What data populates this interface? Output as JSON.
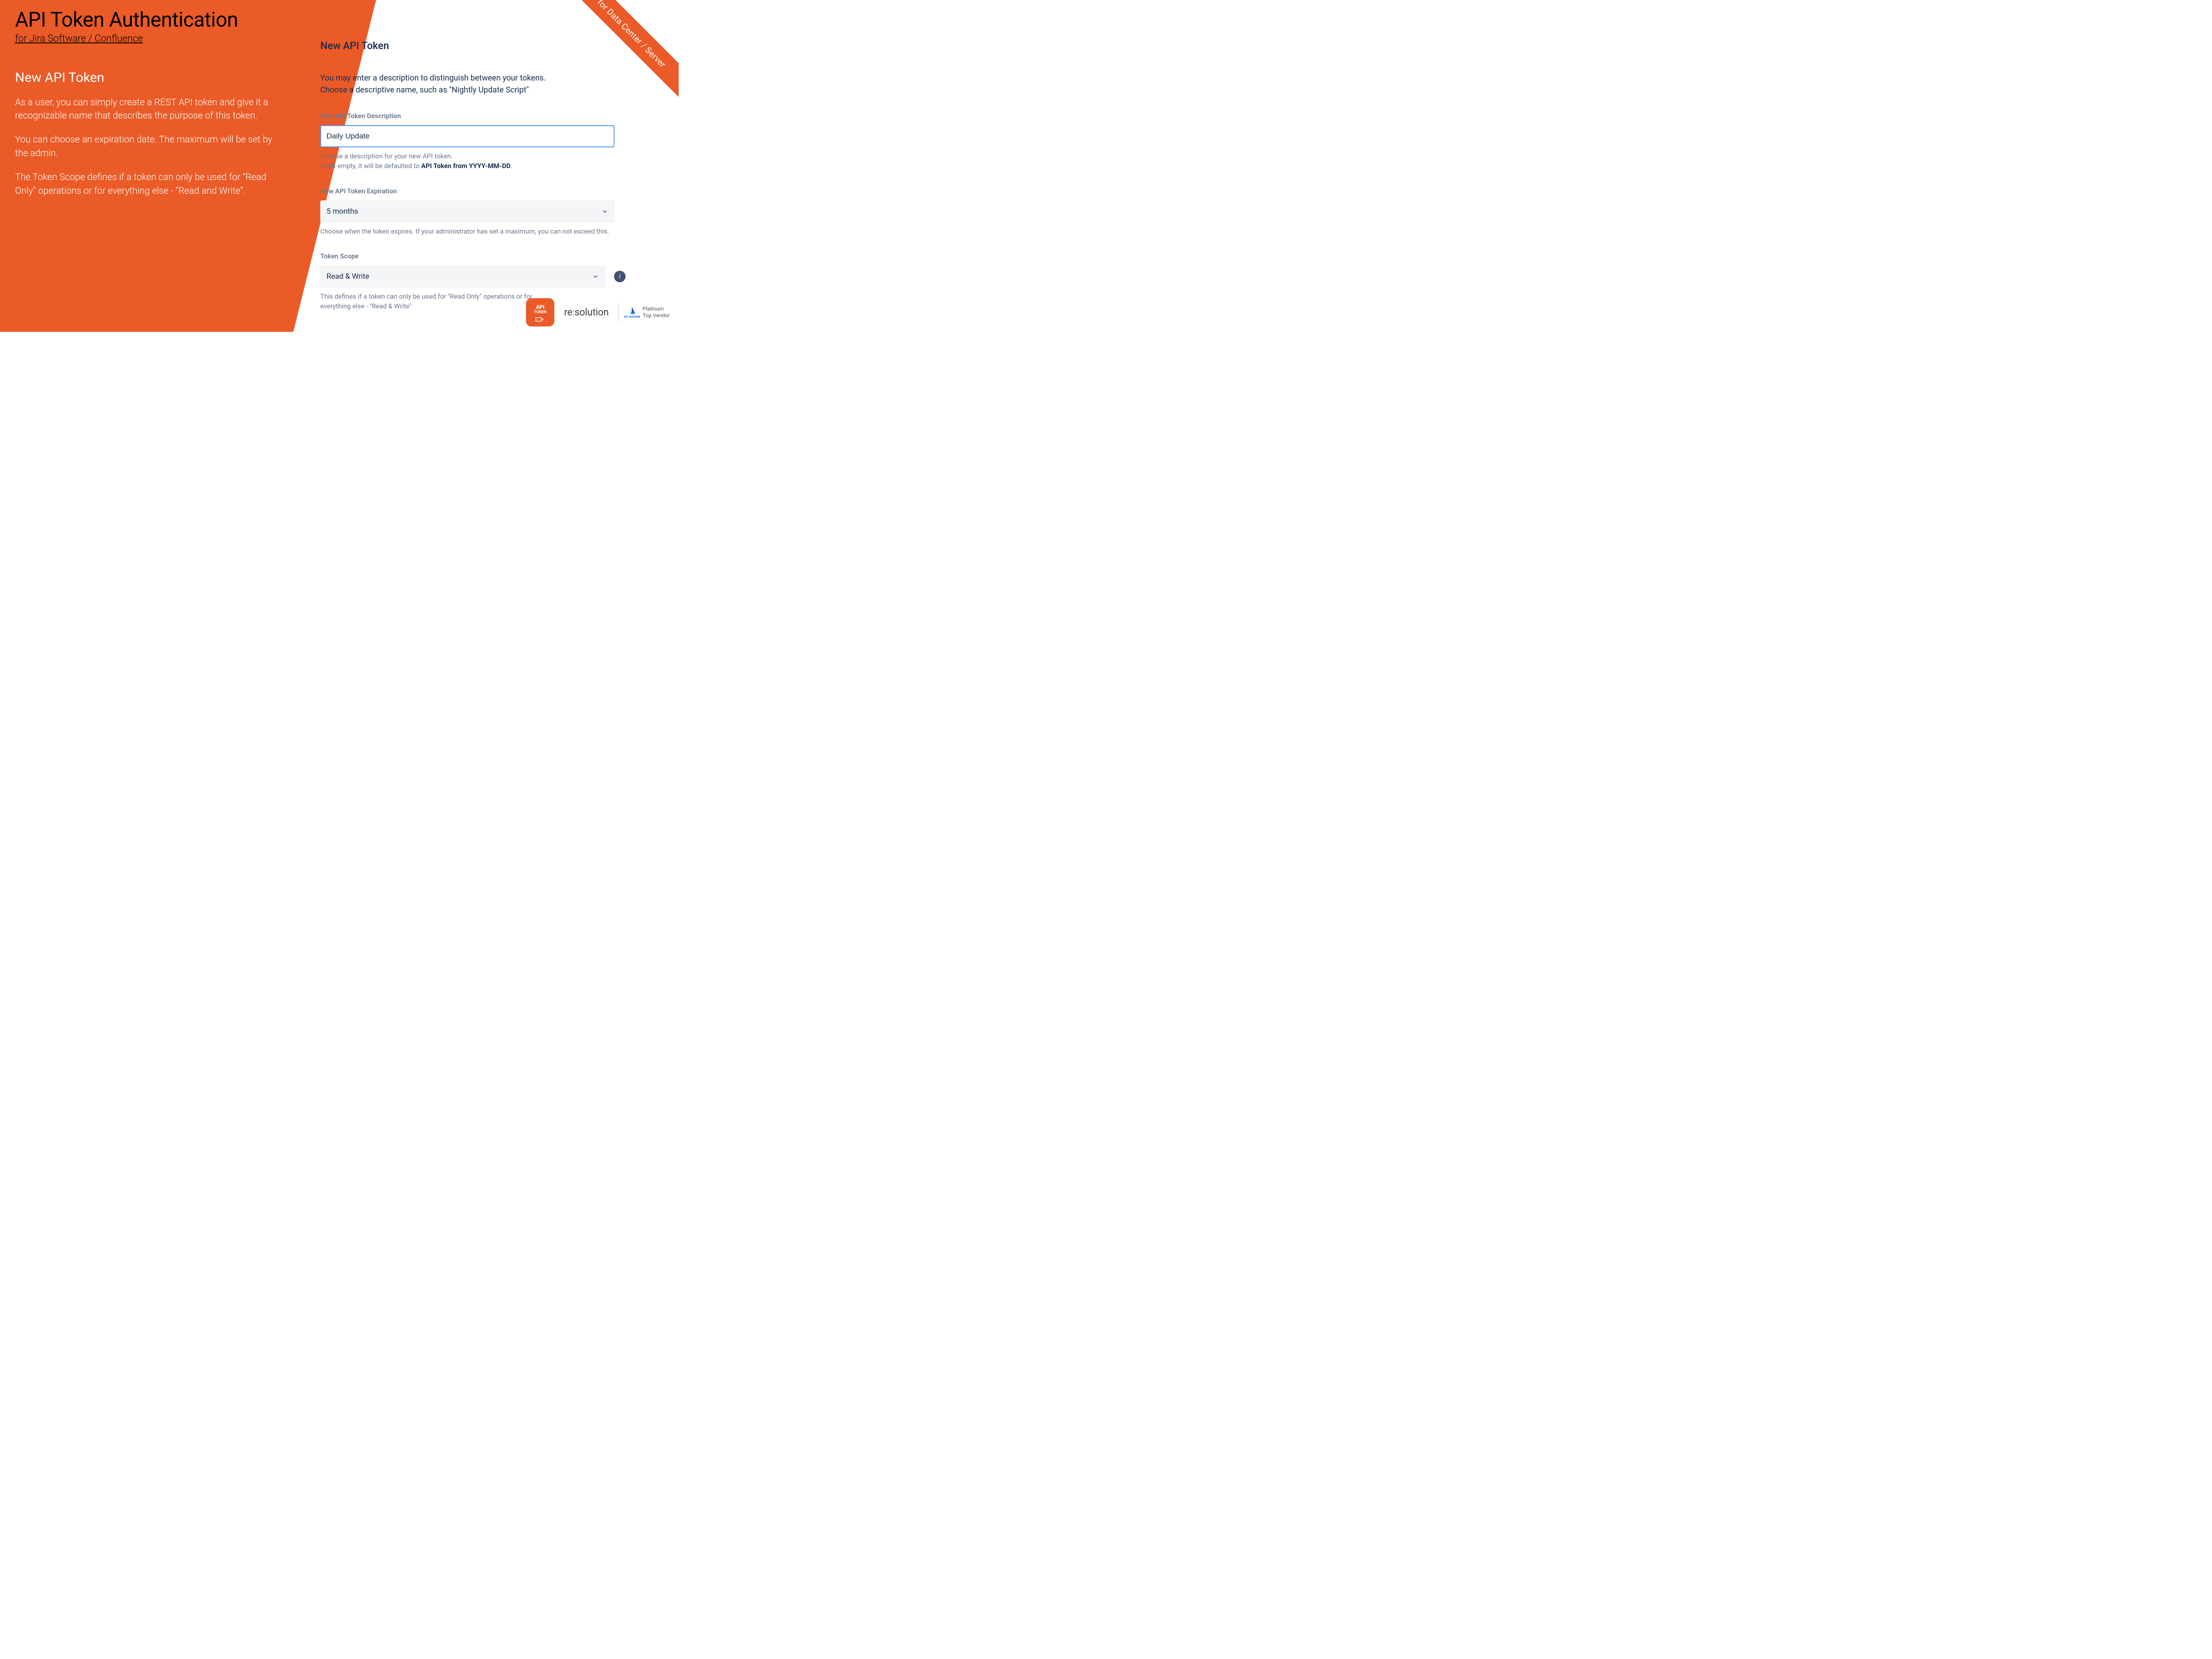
{
  "header": {
    "title": "API Token Authentication",
    "subtitle": "for Jira Software / Confluence"
  },
  "left": {
    "heading": "New API Token",
    "p1": "As a user, you can simply create a REST API token and give it a recognizable name that describes the purpose of this token.",
    "p2": "You can choose an expiration date. The maximum will be set by the admin.",
    "p3": "The Token Scope defines if a token can only be used for “Read Only” operations or for everything else - “Read and Write”."
  },
  "form": {
    "title": "New API Token",
    "intro_l1": "You may enter a description to distinguish between your tokens.",
    "intro_l2": "Choose a descriptive name, such as \"Nightly Update Script\"",
    "description": {
      "label": "New API Token Description",
      "value": "Daily Update",
      "help_pre": "Choose a description for your new API token.",
      "help_pre2": "If left empty, it will be defaulted to ",
      "help_bold": "API Token from YYYY-MM-DD",
      "help_post": "."
    },
    "expiration": {
      "label": "New API Token Expiration",
      "value": "5 months",
      "help": "Choose when the token expires. If your administrator has set a maximum, you can not exceed this."
    },
    "scope": {
      "label": "Token Scope",
      "value": "Read & Write",
      "help": "This defines if a token can only be used for \"Read Only\" operations or for everything else - \"Read & Write\""
    }
  },
  "ribbon": "for Data Center / Server",
  "footer": {
    "api_token_l1": "API",
    "api_token_l2": "TOKEN",
    "resolution_pre": "re",
    "resolution_colon": ":",
    "resolution_post": "solution",
    "atlassian": "ATLASSIAN",
    "vendor_l1": "Platinum",
    "vendor_l2": "Top Vendor"
  }
}
